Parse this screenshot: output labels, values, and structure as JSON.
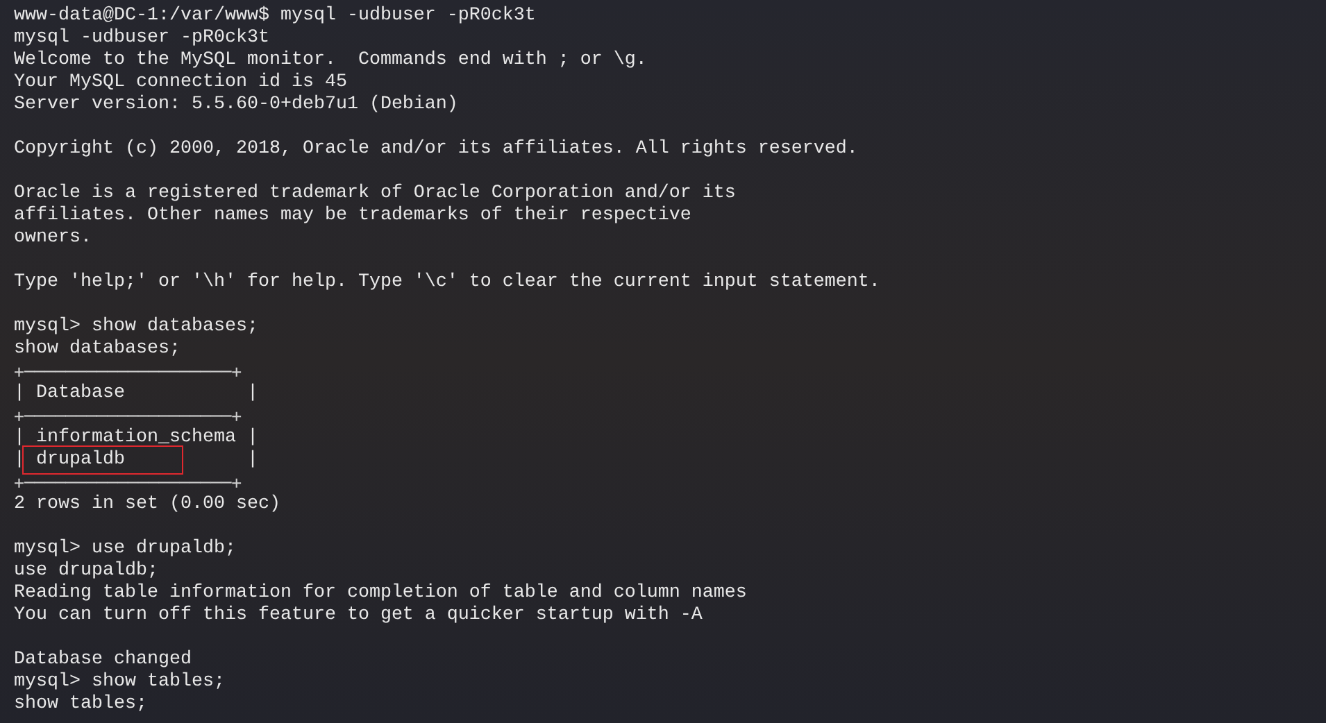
{
  "terminal": {
    "lines": [
      {
        "kind": "text",
        "text": "www-data@DC-1:/var/www$ mysql -udbuser -pR0ck3t"
      },
      {
        "kind": "text",
        "text": "mysql -udbuser -pR0ck3t"
      },
      {
        "kind": "text",
        "text": "Welcome to the MySQL monitor.  Commands end with ; or \\g."
      },
      {
        "kind": "text",
        "text": "Your MySQL connection id is 45"
      },
      {
        "kind": "text",
        "text": "Server version: 5.5.60-0+deb7u1 (Debian)"
      },
      {
        "kind": "blank"
      },
      {
        "kind": "text",
        "text": "Copyright (c) 2000, 2018, Oracle and/or its affiliates. All rights reserved."
      },
      {
        "kind": "blank"
      },
      {
        "kind": "text",
        "text": "Oracle is a registered trademark of Oracle Corporation and/or its"
      },
      {
        "kind": "text",
        "text": "affiliates. Other names may be trademarks of their respective"
      },
      {
        "kind": "text",
        "text": "owners."
      },
      {
        "kind": "blank"
      },
      {
        "kind": "text",
        "text": "Type 'help;' or '\\h' for help. Type '\\c' to clear the current input statement."
      },
      {
        "kind": "blank"
      },
      {
        "kind": "text",
        "text": "mysql> show databases;"
      },
      {
        "kind": "text",
        "text": "show databases;"
      },
      {
        "kind": "border",
        "text": "+────────────────────+"
      },
      {
        "kind": "row",
        "text": "| Database           |",
        "highlighted": false
      },
      {
        "kind": "border",
        "text": "+────────────────────+"
      },
      {
        "kind": "row",
        "text": "| information_schema |",
        "highlighted": false
      },
      {
        "kind": "row",
        "text": "| drupaldb           |",
        "highlighted": true
      },
      {
        "kind": "border",
        "text": "+────────────────────+"
      },
      {
        "kind": "text",
        "text": "2 rows in set (0.00 sec)"
      },
      {
        "kind": "blank"
      },
      {
        "kind": "text",
        "text": "mysql> use drupaldb;"
      },
      {
        "kind": "text",
        "text": "use drupaldb;"
      },
      {
        "kind": "text",
        "text": "Reading table information for completion of table and column names"
      },
      {
        "kind": "text",
        "text": "You can turn off this feature to get a quicker startup with -A"
      },
      {
        "kind": "blank"
      },
      {
        "kind": "text",
        "text": "Database changed"
      },
      {
        "kind": "text",
        "text": "mysql> show tables;"
      },
      {
        "kind": "text",
        "text": "show tables;"
      }
    ]
  }
}
